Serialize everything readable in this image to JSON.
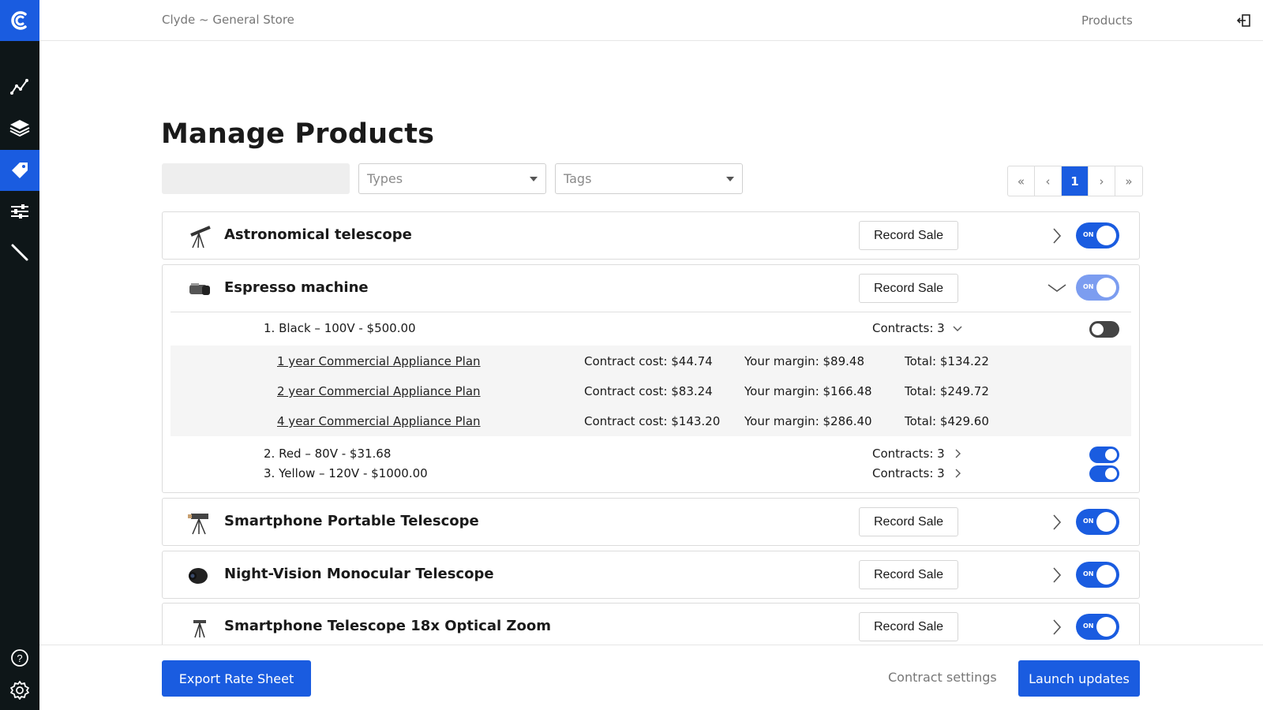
{
  "header": {
    "store_name": "Clyde ~ General Store",
    "section": "Products"
  },
  "sidebar": {
    "items": [
      {
        "icon": "analytics-icon"
      },
      {
        "icon": "layers-icon"
      },
      {
        "icon": "tag-icon",
        "active": true
      },
      {
        "icon": "sliders-icon"
      },
      {
        "icon": "pen-icon"
      }
    ],
    "bottom": [
      {
        "icon": "help-icon"
      },
      {
        "icon": "gear-icon"
      }
    ]
  },
  "page": {
    "title": "Manage Products",
    "search_placeholder": "",
    "types_placeholder": "Types",
    "tags_placeholder": "Tags",
    "pager": {
      "first": "«",
      "prev": "‹",
      "current": "1",
      "next": "›",
      "last": "»"
    }
  },
  "products": [
    {
      "name": "Astronomical telescope",
      "record_label": "Record Sale",
      "toggle": "ON"
    },
    {
      "name": "Espresso machine",
      "record_label": "Record Sale",
      "toggle": "ON",
      "variants": [
        {
          "label": "1. Black – 100V - $500.00",
          "contracts": "Contracts: 3"
        },
        {
          "label": "2. Red – 80V - $31.68",
          "contracts": "Contracts: 3"
        },
        {
          "label": "3. Yellow – 120V - $1000.00",
          "contracts": "Contracts: 3"
        }
      ],
      "plans": [
        {
          "name": "1 year Commercial Appliance Plan",
          "cost": "Contract cost: $44.74",
          "margin": "Your margin: $89.48",
          "total": "Total: $134.22"
        },
        {
          "name": "2 year Commercial Appliance Plan",
          "cost": "Contract cost: $83.24",
          "margin": "Your margin: $166.48",
          "total": "Total: $249.72"
        },
        {
          "name": "4 year Commercial Appliance Plan",
          "cost": "Contract cost: $143.20",
          "margin": "Your margin: $286.40",
          "total": "Total: $429.60"
        }
      ]
    },
    {
      "name": "Smartphone Portable Telescope",
      "record_label": "Record Sale",
      "toggle": "ON"
    },
    {
      "name": "Night-Vision Monocular Telescope",
      "record_label": "Record Sale",
      "toggle": "ON"
    },
    {
      "name": "Smartphone Telescope 18x Optical Zoom",
      "record_label": "Record Sale",
      "toggle": "ON"
    }
  ],
  "footer": {
    "export_label": "Export Rate Sheet",
    "contract_settings": "Contract settings",
    "launch_label": "Launch updates"
  },
  "colors": {
    "accent": "#1a5ce0",
    "sidebar": "#0e1618"
  }
}
